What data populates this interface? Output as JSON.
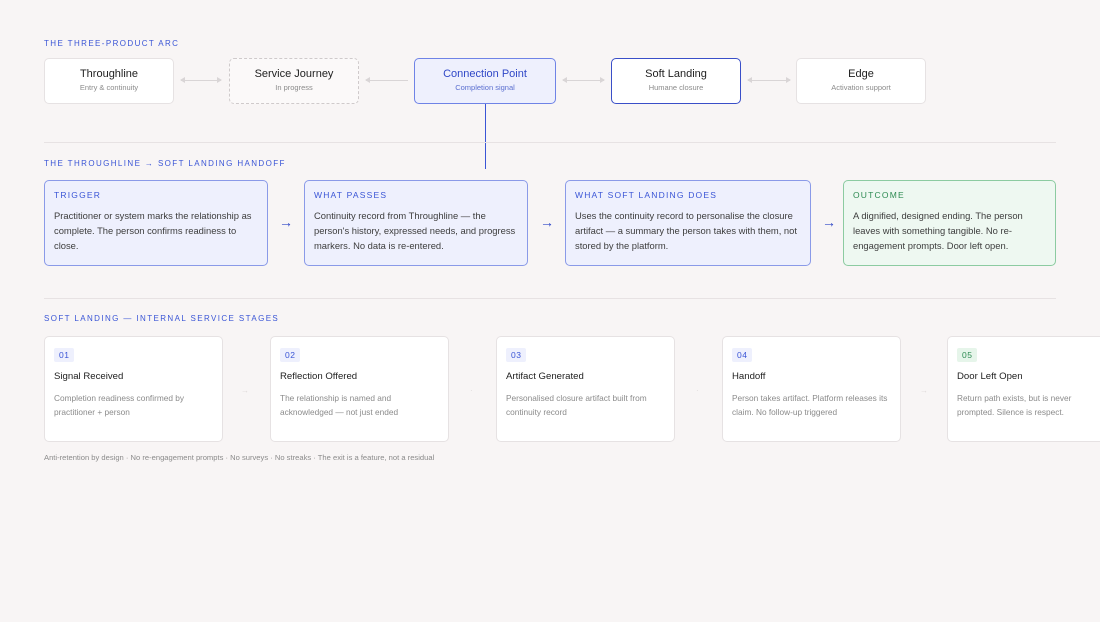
{
  "arc": {
    "label": "THE THREE-PRODUCT ARC",
    "items": [
      {
        "title": "Throughline",
        "subtitle": "Entry & continuity"
      },
      {
        "title": "Service Journey",
        "subtitle": "In progress"
      },
      {
        "title": "Connection Point",
        "subtitle": "Completion signal"
      },
      {
        "title": "Soft Landing",
        "subtitle": "Humane closure"
      },
      {
        "title": "Edge",
        "subtitle": "Activation support"
      }
    ]
  },
  "handoff": {
    "label": "THE THROUGHLINE → SOFT LANDING HANDOFF",
    "cards": [
      {
        "heading": "TRIGGER",
        "body": "Practitioner or system marks the relationship as complete. The person confirms readiness to close."
      },
      {
        "heading": "WHAT PASSES",
        "body": "Continuity record from Throughline — the person's history, expressed needs, and progress markers. No data is re-entered."
      },
      {
        "heading": "WHAT SOFT LANDING DOES",
        "body": "Uses the continuity record to personalise the closure artifact — a summary the person takes with them, not stored by the platform."
      },
      {
        "heading": "OUTCOME",
        "body": "A dignified, designed ending. The person leaves with something tangible. No re-engagement prompts. Door left open."
      }
    ],
    "arrow_glyph": "→"
  },
  "stages": {
    "label": "SOFT LANDING — INTERNAL SERVICE STAGES",
    "items": [
      {
        "num": "01",
        "title": "Signal Received",
        "desc": "Completion readiness confirmed by practitioner + person"
      },
      {
        "num": "02",
        "title": "Reflection Offered",
        "desc": "The relationship is named and acknowledged — not just ended"
      },
      {
        "num": "03",
        "title": "Artifact Generated",
        "desc": "Personalised closure artifact built from continuity record"
      },
      {
        "num": "04",
        "title": "Handoff",
        "desc": "Person takes artifact. Platform releases its claim. No follow-up triggered"
      },
      {
        "num": "05",
        "title": "Door Left Open",
        "desc": "Return path exists, but is never prompted. Silence is respect."
      }
    ],
    "separators": [
      "→",
      "·",
      "·",
      "→"
    ]
  },
  "footnote": "Anti-retention by design · No re-engagement prompts · No surveys · No streaks · The exit is a feature, not a residual",
  "colors": {
    "accent": "#3a55d6",
    "green": "#2e8b53",
    "background": "#f8f5f5"
  }
}
